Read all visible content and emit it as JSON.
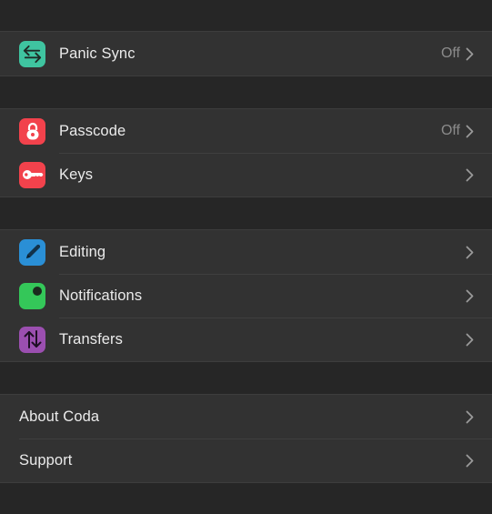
{
  "sections": [
    {
      "items": [
        {
          "label": "Panic Sync",
          "value": "Off",
          "icon": "sync-arrows-icon",
          "color": "#3fc4a0"
        }
      ]
    },
    {
      "items": [
        {
          "label": "Passcode",
          "value": "Off",
          "icon": "lock-icon",
          "color": "#f2424c"
        },
        {
          "label": "Keys",
          "icon": "key-icon",
          "color": "#f2424c"
        }
      ]
    },
    {
      "items": [
        {
          "label": "Editing",
          "icon": "pencil-icon",
          "color": "#2a8fd6"
        },
        {
          "label": "Notifications",
          "icon": "notification-badge-icon",
          "color": "#34c759"
        },
        {
          "label": "Transfers",
          "icon": "transfer-arrows-icon",
          "color": "#9b4fb0"
        }
      ]
    },
    {
      "items": [
        {
          "label": "About Coda"
        },
        {
          "label": "Support"
        }
      ]
    }
  ]
}
